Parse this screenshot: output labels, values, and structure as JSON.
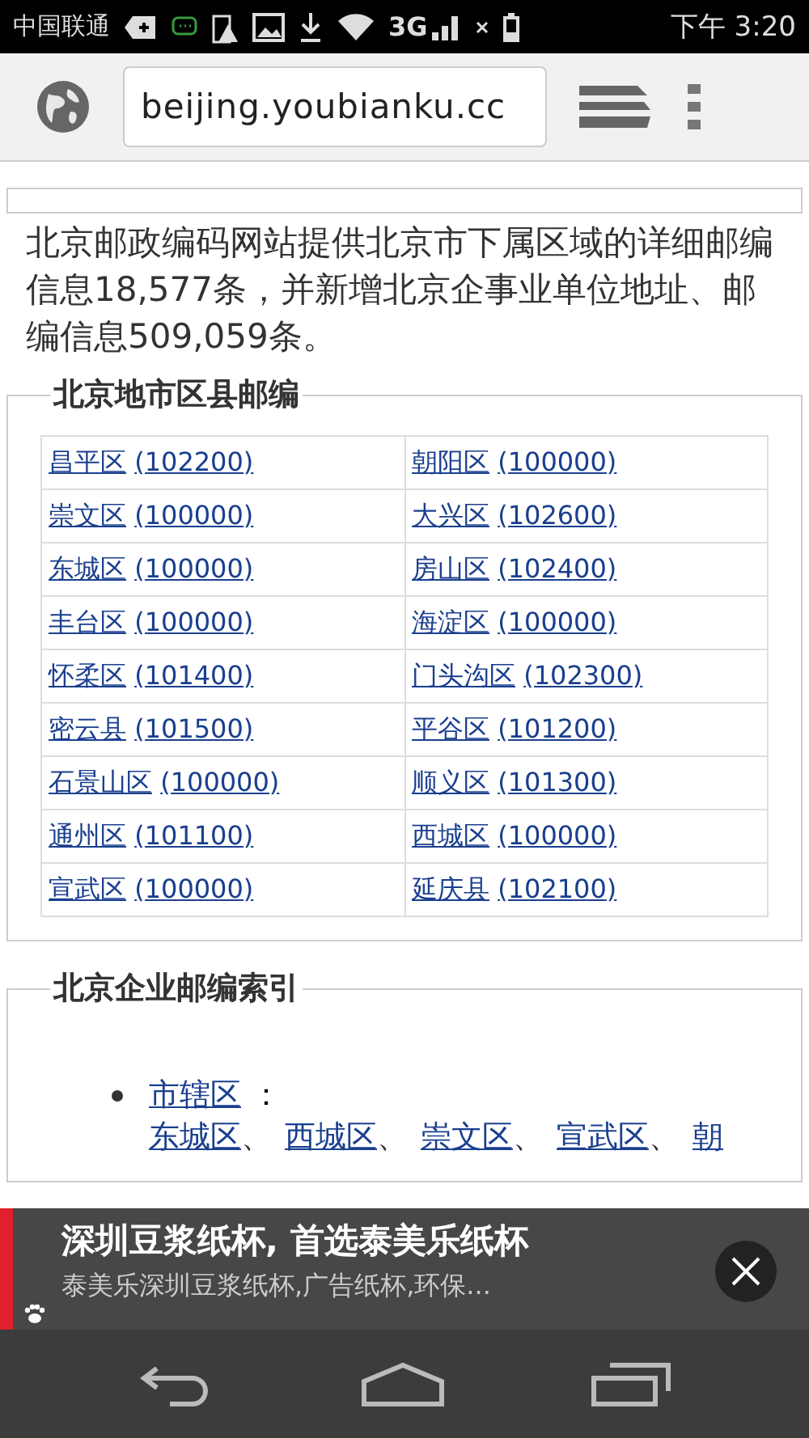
{
  "status_bar": {
    "carrier": "中国联通",
    "network": "3G",
    "time": "下午 3:20"
  },
  "browser": {
    "url": "beijing.youbianku.cc"
  },
  "intro": "北京邮政编码网站提供北京市下属区域的详细邮编信息18,577条，并新增北京企事业单位地址、邮编信息509,059条。",
  "districts": {
    "title": "北京地市区县邮编",
    "rows": [
      [
        {
          "name": "昌平区",
          "code": "(102200)"
        },
        {
          "name": "朝阳区",
          "code": "(100000)"
        }
      ],
      [
        {
          "name": "崇文区",
          "code": "(100000)"
        },
        {
          "name": "大兴区",
          "code": "(102600)"
        }
      ],
      [
        {
          "name": "东城区",
          "code": "(100000)"
        },
        {
          "name": "房山区",
          "code": "(102400)"
        }
      ],
      [
        {
          "name": "丰台区",
          "code": "(100000)"
        },
        {
          "name": "海淀区",
          "code": "(100000)"
        }
      ],
      [
        {
          "name": "怀柔区",
          "code": "(101400)"
        },
        {
          "name": "门头沟区",
          "code": "(102300)"
        }
      ],
      [
        {
          "name": "密云县",
          "code": "(101500)"
        },
        {
          "name": "平谷区",
          "code": "(101200)"
        }
      ],
      [
        {
          "name": "石景山区",
          "code": "(100000)"
        },
        {
          "name": "顺义区",
          "code": "(101300)"
        }
      ],
      [
        {
          "name": "通州区",
          "code": "(101100)"
        },
        {
          "name": "西城区",
          "code": "(100000)"
        }
      ],
      [
        {
          "name": "宣武区",
          "code": "(100000)"
        },
        {
          "name": "延庆县",
          "code": "(102100)"
        }
      ]
    ]
  },
  "enterprise": {
    "title": "北京企业邮编索引",
    "group": "市辖区",
    "separator": "：",
    "links": [
      {
        "name": "东城区",
        "after": "、"
      },
      {
        "name": "西城区",
        "after": "、"
      },
      {
        "name": "崇文区",
        "after": "、"
      },
      {
        "name": "宣武区",
        "after": "、"
      },
      {
        "name": "朝"
      }
    ]
  },
  "ad": {
    "title": "深圳豆浆纸杯, 首选泰美乐纸杯",
    "subtitle": "泰美乐深圳豆浆纸杯,广告纸杯,环保..."
  }
}
